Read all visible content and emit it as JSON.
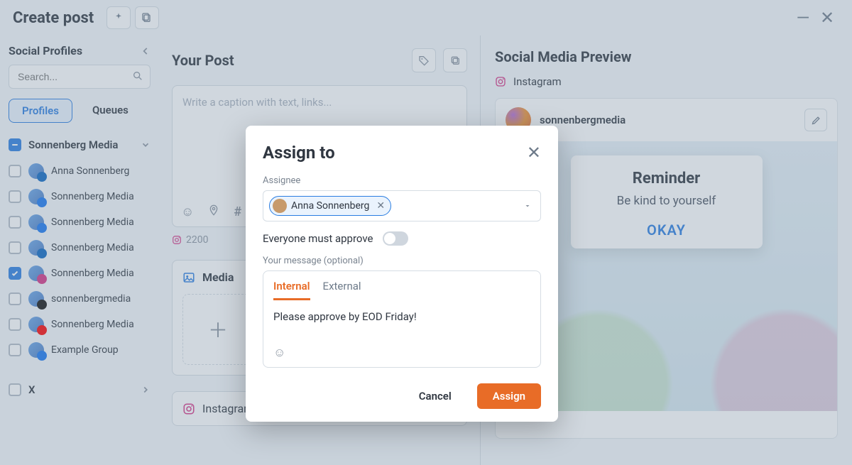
{
  "header": {
    "title": "Create post"
  },
  "sidebar": {
    "title": "Social Profiles",
    "search_placeholder": "Search...",
    "tabs": {
      "profiles": "Profiles",
      "queues": "Queues"
    },
    "group": {
      "name": "Sonnenberg Media",
      "items": [
        {
          "label": "Anna Sonnenberg",
          "checked": false,
          "badge": "li",
          "color": "#0a66c2"
        },
        {
          "label": "Sonnenberg Media",
          "checked": false,
          "badge": "fb",
          "color": "#1877f2"
        },
        {
          "label": "Sonnenberg Media",
          "checked": false,
          "badge": "fb",
          "color": "#1877f2"
        },
        {
          "label": "Sonnenberg Media",
          "checked": false,
          "badge": "li",
          "color": "#0a66c2"
        },
        {
          "label": "Sonnenberg Media",
          "checked": true,
          "badge": "ig",
          "color": "#d63384"
        },
        {
          "label": "sonnenbergmedia",
          "checked": false,
          "badge": "tt",
          "color": "#111"
        },
        {
          "label": "Sonnenberg Media",
          "checked": false,
          "badge": "yt",
          "color": "#ff0000"
        },
        {
          "label": "Example Group",
          "checked": false,
          "badge": "fb",
          "color": "#1877f2"
        }
      ]
    },
    "x_group": "X"
  },
  "composer": {
    "heading": "Your Post",
    "placeholder": "Write a caption with text, links...",
    "remaining": "2200",
    "media_heading": "Media",
    "network_heading": "Instagram"
  },
  "preview": {
    "heading": "Social Media Preview",
    "network": "Instagram",
    "account": "sonnenbergmedia",
    "reminder": {
      "title": "Reminder",
      "body": "Be kind to yourself",
      "ok": "OKAY"
    }
  },
  "modal": {
    "title": "Assign to",
    "assignee_label": "Assignee",
    "chip_name": "Anna Sonnenberg",
    "approve_label": "Everyone must approve",
    "message_label": "Your message (optional)",
    "tabs": {
      "internal": "Internal",
      "external": "External"
    },
    "message_body": "Please approve by EOD Friday!",
    "cancel": "Cancel",
    "assign": "Assign"
  },
  "colors": {
    "accent_blue": "#2a7de1",
    "accent_orange": "#e86c27"
  }
}
